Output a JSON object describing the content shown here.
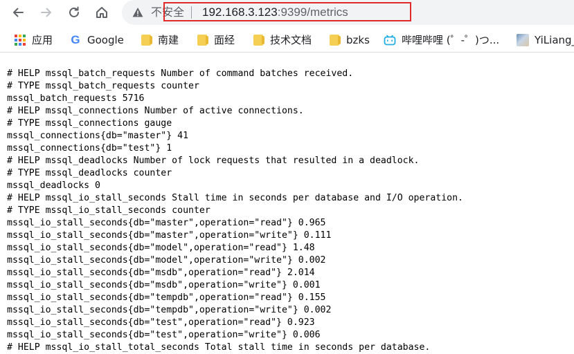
{
  "browser": {
    "address_bar": {
      "security_label": "不安全",
      "url_host": "192.168.3.123",
      "url_rest": ":9399/metrics"
    },
    "icons": {
      "back": "arrow-back-icon",
      "forward": "arrow-forward-icon",
      "reload": "reload-icon",
      "home": "home-icon",
      "security": "warning-triangle-icon"
    },
    "highlight_color": "#e02a2a"
  },
  "bookmarks": [
    {
      "label": "应用",
      "icon": "apps-grid-icon"
    },
    {
      "label": "Google",
      "icon": "google-icon"
    },
    {
      "label": "南建",
      "icon": "folder-icon"
    },
    {
      "label": "面经",
      "icon": "folder-icon"
    },
    {
      "label": "技术文档",
      "icon": "folder-icon"
    },
    {
      "label": "bzks",
      "icon": "folder-icon"
    },
    {
      "label": "哔哩哔哩 (゜-゜)つ...",
      "icon": "bilibili-icon"
    },
    {
      "label": "YiLiang_",
      "icon": "avatar-icon"
    }
  ],
  "metrics_lines": [
    "# HELP mssql_batch_requests Number of command batches received.",
    "# TYPE mssql_batch_requests counter",
    "mssql_batch_requests 5716",
    "# HELP mssql_connections Number of active connections.",
    "# TYPE mssql_connections gauge",
    "mssql_connections{db=\"master\"} 41",
    "mssql_connections{db=\"test\"} 1",
    "# HELP mssql_deadlocks Number of lock requests that resulted in a deadlock.",
    "# TYPE mssql_deadlocks counter",
    "mssql_deadlocks 0",
    "# HELP mssql_io_stall_seconds Stall time in seconds per database and I/O operation.",
    "# TYPE mssql_io_stall_seconds counter",
    "mssql_io_stall_seconds{db=\"master\",operation=\"read\"} 0.965",
    "mssql_io_stall_seconds{db=\"master\",operation=\"write\"} 0.111",
    "mssql_io_stall_seconds{db=\"model\",operation=\"read\"} 1.48",
    "mssql_io_stall_seconds{db=\"model\",operation=\"write\"} 0.002",
    "mssql_io_stall_seconds{db=\"msdb\",operation=\"read\"} 2.014",
    "mssql_io_stall_seconds{db=\"msdb\",operation=\"write\"} 0.001",
    "mssql_io_stall_seconds{db=\"tempdb\",operation=\"read\"} 0.155",
    "mssql_io_stall_seconds{db=\"tempdb\",operation=\"write\"} 0.002",
    "mssql_io_stall_seconds{db=\"test\",operation=\"read\"} 0.923",
    "mssql_io_stall_seconds{db=\"test\",operation=\"write\"} 0.006",
    "# HELP mssql_io_stall_total_seconds Total stall time in seconds per database."
  ]
}
